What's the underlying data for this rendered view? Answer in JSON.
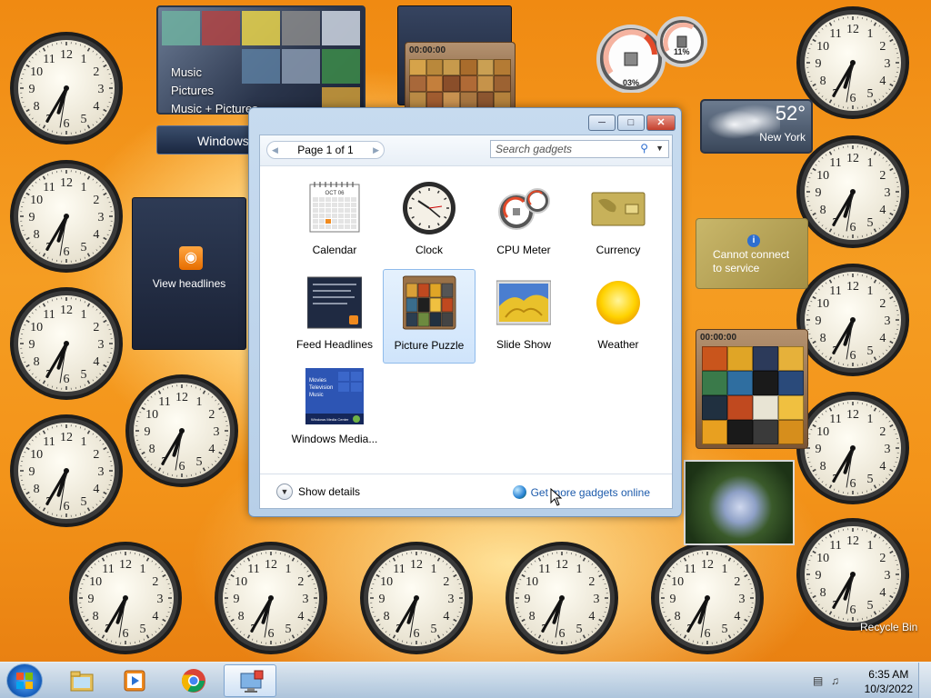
{
  "desktop": {
    "media_center": {
      "menu": [
        "Music",
        "Pictures",
        "Music + Pictures"
      ],
      "bar_label": "Windows"
    },
    "puzzle_small_timer": "00:00:00",
    "puzzle_large_timer": "00:00:00",
    "cpu_meter": {
      "cpu": "03%",
      "memory": "11%"
    },
    "weather": {
      "temp": "52°",
      "city": "New York"
    },
    "currency": {
      "message_line1": "Cannot connect",
      "message_line2": "to service"
    },
    "feed": {
      "label": "View headlines"
    },
    "recycle_bin_label": "Recycle Bin"
  },
  "gallery": {
    "pager": "Page 1 of 1",
    "search_placeholder": "Search gadgets",
    "items": [
      {
        "name": "Calendar",
        "icon": "calendar-icon"
      },
      {
        "name": "Clock",
        "icon": "clock-icon"
      },
      {
        "name": "CPU Meter",
        "icon": "cpu-meter-icon"
      },
      {
        "name": "Currency",
        "icon": "currency-icon"
      },
      {
        "name": "Feed Headlines",
        "icon": "feed-icon"
      },
      {
        "name": "Picture Puzzle",
        "icon": "puzzle-icon",
        "selected": true
      },
      {
        "name": "Slide Show",
        "icon": "slideshow-icon"
      },
      {
        "name": "Weather",
        "icon": "weather-icon"
      },
      {
        "name": "Windows Media...",
        "icon": "media-center-icon"
      }
    ],
    "calendar_month": "OCT 06",
    "show_details": "Show details",
    "online_link": "Get more gadgets online",
    "media_thumb_menu": [
      "Movies",
      "Television",
      "Music"
    ],
    "media_thumb_bar": "Windows Media Center"
  },
  "taskbar": {
    "time": "6:35 AM",
    "date": "10/3/2022"
  }
}
